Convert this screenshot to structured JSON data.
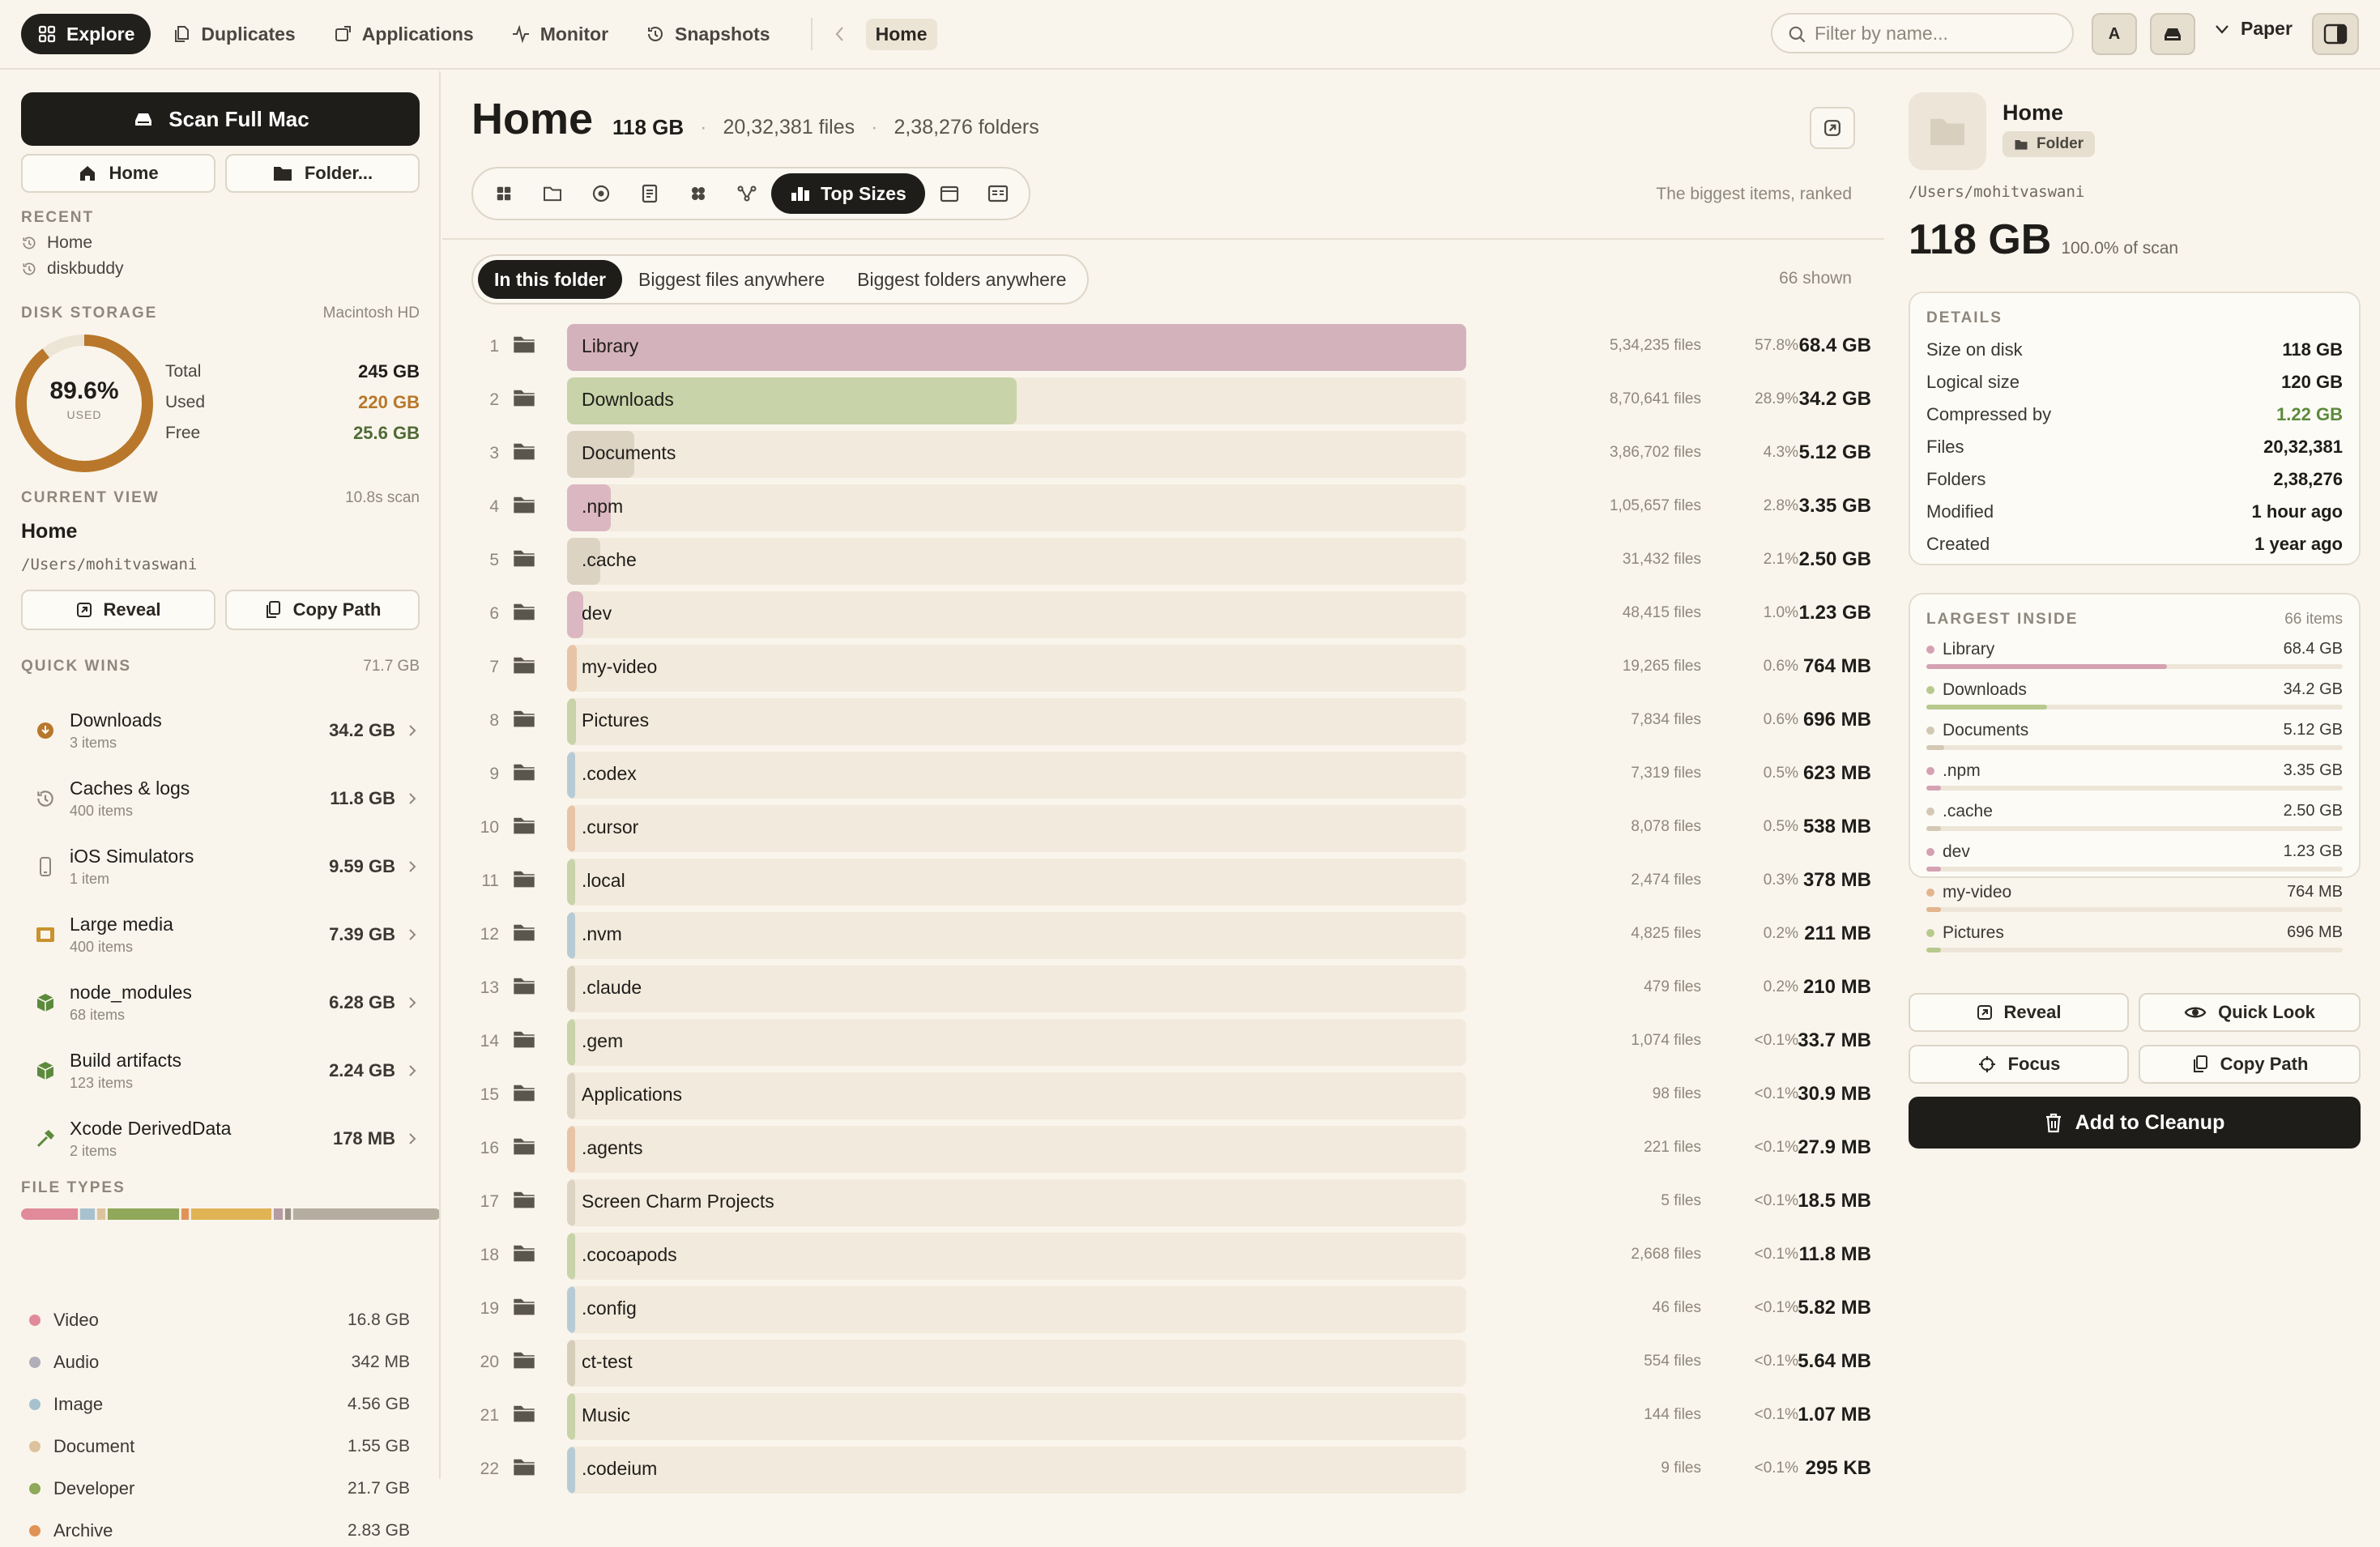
{
  "nav": {
    "tabs": [
      {
        "label": "Explore",
        "icon": "grid-icon"
      },
      {
        "label": "Duplicates",
        "icon": "files-icon"
      },
      {
        "label": "Applications",
        "icon": "app-icon"
      },
      {
        "label": "Monitor",
        "icon": "pulse-icon"
      },
      {
        "label": "Snapshots",
        "icon": "history-icon"
      }
    ],
    "breadcrumb": "Home",
    "search_placeholder": "Filter by name...",
    "avatar_letter": "A",
    "theme_label": "Paper"
  },
  "sidebar": {
    "scan_button": "Scan Full Mac",
    "home_button": "Home",
    "folder_button": "Folder...",
    "recent_heading": "RECENT",
    "recent": [
      "Home",
      "diskbuddy"
    ],
    "disk_heading": "DISK STORAGE",
    "disk_name": "Macintosh HD",
    "disk_percent": "89.6%",
    "disk_percent_value": 89.6,
    "disk_used_caption": "USED",
    "disk_rows": [
      {
        "label": "Total",
        "value": "245 GB",
        "color": "#1f1d1a"
      },
      {
        "label": "Used",
        "value": "220 GB",
        "color": "#b8772a"
      },
      {
        "label": "Free",
        "value": "25.6 GB",
        "color": "#4f6b35"
      }
    ],
    "current_heading": "CURRENT VIEW",
    "current_scan_time": "10.8s scan",
    "current_name": "Home",
    "current_path": "/Users/mohitvaswani",
    "reveal_button": "Reveal",
    "copy_path_button": "Copy Path",
    "quick_heading": "QUICK WINS",
    "quick_total": "71.7 GB",
    "quick_wins": [
      {
        "name": "Downloads",
        "sub": "3 items",
        "size": "34.2 GB",
        "icon": "download-icon",
        "color": "#b8772a"
      },
      {
        "name": "Caches & logs",
        "sub": "400 items",
        "size": "11.8 GB",
        "icon": "history-icon",
        "color": "#8d877c"
      },
      {
        "name": "iOS Simulators",
        "sub": "1 item",
        "size": "9.59 GB",
        "icon": "phone-icon",
        "color": "#8d877c"
      },
      {
        "name": "Large media",
        "sub": "400 items",
        "size": "7.39 GB",
        "icon": "film-icon",
        "color": "#c9922f"
      },
      {
        "name": "node_modules",
        "sub": "68 items",
        "size": "6.28 GB",
        "icon": "cube-icon",
        "color": "#5c8a3c"
      },
      {
        "name": "Build artifacts",
        "sub": "123 items",
        "size": "2.24 GB",
        "icon": "cube-icon",
        "color": "#5c8a3c"
      },
      {
        "name": "Xcode DerivedData",
        "sub": "2 items",
        "size": "178 MB",
        "icon": "hammer-icon",
        "color": "#5c8a3c"
      }
    ],
    "filetypes_heading": "FILE TYPES",
    "filetype_bar": [
      {
        "share": 0.135,
        "color": "#e08a9a"
      },
      {
        "share": 0.006,
        "color": "#f1ece2"
      },
      {
        "share": 0.035,
        "color": "#a7c1cf"
      },
      {
        "share": 0.006,
        "color": "#f1ece2"
      },
      {
        "share": 0.018,
        "color": "#dcc39d"
      },
      {
        "share": 0.006,
        "color": "#f1ece2"
      },
      {
        "share": 0.17,
        "color": "#8fa85a"
      },
      {
        "share": 0.006,
        "color": "#f1ece2"
      },
      {
        "share": 0.018,
        "color": "#e09357"
      },
      {
        "share": 0.006,
        "color": "#f1ece2"
      },
      {
        "share": 0.19,
        "color": "#e0b355"
      },
      {
        "share": 0.006,
        "color": "#f1ece2"
      },
      {
        "share": 0.022,
        "color": "#b59ba2"
      },
      {
        "share": 0.006,
        "color": "#f1ece2"
      },
      {
        "share": 0.012,
        "color": "#9b9187"
      },
      {
        "share": 0.006,
        "color": "#f1ece2"
      },
      {
        "share": 0.348,
        "color": "#b5ad9f"
      }
    ],
    "file_types": [
      {
        "name": "Video",
        "size": "16.8 GB",
        "color": "#e08a9a"
      },
      {
        "name": "Audio",
        "size": "342 MB",
        "color": "#b0aeb8"
      },
      {
        "name": "Image",
        "size": "4.56 GB",
        "color": "#a7c1cf"
      },
      {
        "name": "Document",
        "size": "1.55 GB",
        "color": "#dcc39d"
      },
      {
        "name": "Developer",
        "size": "21.7 GB",
        "color": "#8fa85a"
      },
      {
        "name": "Archive",
        "size": "2.83 GB",
        "color": "#e09357"
      }
    ]
  },
  "main": {
    "title": "Home",
    "size": "118 GB",
    "files": "20,32,381 files",
    "folders": "2,38,276 folders",
    "active_view": "Top Sizes",
    "view_hint": "The biggest items, ranked",
    "scopes": [
      "In this folder",
      "Biggest files anywhere",
      "Biggest folders anywhere"
    ],
    "shown_count": "66 shown",
    "rows": [
      {
        "rank": "1",
        "name": "Library",
        "files": "5,34,235 files",
        "pct": "57.8%",
        "size": "68.4 GB",
        "share": 1.0,
        "color": "#d4b2bc"
      },
      {
        "rank": "2",
        "name": "Downloads",
        "files": "8,70,641 files",
        "pct": "28.9%",
        "size": "34.2 GB",
        "share": 0.5,
        "color": "#c8d3a9"
      },
      {
        "rank": "3",
        "name": "Documents",
        "files": "3,86,702 files",
        "pct": "4.3%",
        "size": "5.12 GB",
        "share": 0.075,
        "color": "#dcd3c3"
      },
      {
        "rank": "4",
        "name": ".npm",
        "files": "1,05,657 files",
        "pct": "2.8%",
        "size": "3.35 GB",
        "share": 0.049,
        "color": "#dbb7c1"
      },
      {
        "rank": "5",
        "name": ".cache",
        "files": "31,432 files",
        "pct": "2.1%",
        "size": "2.50 GB",
        "share": 0.037,
        "color": "#dcd3c3"
      },
      {
        "rank": "6",
        "name": "dev",
        "files": "48,415 files",
        "pct": "1.0%",
        "size": "1.23 GB",
        "share": 0.018,
        "color": "#dbb7c1"
      },
      {
        "rank": "7",
        "name": "my-video",
        "files": "19,265 files",
        "pct": "0.6%",
        "size": "764 MB",
        "share": 0.011,
        "color": "#e8c4a6"
      },
      {
        "rank": "8",
        "name": "Pictures",
        "files": "7,834 files",
        "pct": "0.6%",
        "size": "696 MB",
        "share": 0.01,
        "color": "#c8d3a9"
      },
      {
        "rank": "9",
        "name": ".codex",
        "files": "7,319 files",
        "pct": "0.5%",
        "size": "623 MB",
        "share": 0.009,
        "color": "#b7cbd5"
      },
      {
        "rank": "10",
        "name": ".cursor",
        "files": "8,078 files",
        "pct": "0.5%",
        "size": "538 MB",
        "share": 0.008,
        "color": "#e8c4a6"
      },
      {
        "rank": "11",
        "name": ".local",
        "files": "2,474 files",
        "pct": "0.3%",
        "size": "378 MB",
        "share": 0.006,
        "color": "#c8d3a9"
      },
      {
        "rank": "12",
        "name": ".nvm",
        "files": "4,825 files",
        "pct": "0.2%",
        "size": "211 MB",
        "share": 0.005,
        "color": "#b7cbd5"
      },
      {
        "rank": "13",
        "name": ".claude",
        "files": "479 files",
        "pct": "0.2%",
        "size": "210 MB",
        "share": 0.005,
        "color": "#d6cdb9"
      },
      {
        "rank": "14",
        "name": ".gem",
        "files": "1,074 files",
        "pct": "<0.1%",
        "size": "33.7 MB",
        "share": 0.004,
        "color": "#c8d3a9"
      },
      {
        "rank": "15",
        "name": "Applications",
        "files": "98 files",
        "pct": "<0.1%",
        "size": "30.9 MB",
        "share": 0.004,
        "color": "#dcd3c3"
      },
      {
        "rank": "16",
        "name": ".agents",
        "files": "221 files",
        "pct": "<0.1%",
        "size": "27.9 MB",
        "share": 0.004,
        "color": "#e8c4a6"
      },
      {
        "rank": "17",
        "name": "Screen Charm Projects",
        "files": "5 files",
        "pct": "<0.1%",
        "size": "18.5 MB",
        "share": 0.004,
        "color": "#dcd3c3"
      },
      {
        "rank": "18",
        "name": ".cocoapods",
        "files": "2,668 files",
        "pct": "<0.1%",
        "size": "11.8 MB",
        "share": 0.004,
        "color": "#c8d3a9"
      },
      {
        "rank": "19",
        "name": ".config",
        "files": "46 files",
        "pct": "<0.1%",
        "size": "5.82 MB",
        "share": 0.004,
        "color": "#b7cbd5"
      },
      {
        "rank": "20",
        "name": "ct-test",
        "files": "554 files",
        "pct": "<0.1%",
        "size": "5.64 MB",
        "share": 0.004,
        "color": "#d6cdb9"
      },
      {
        "rank": "21",
        "name": "Music",
        "files": "144 files",
        "pct": "<0.1%",
        "size": "1.07 MB",
        "share": 0.004,
        "color": "#c8d3a9"
      },
      {
        "rank": "22",
        "name": ".codeium",
        "files": "9 files",
        "pct": "<0.1%",
        "size": "295 KB",
        "share": 0.004,
        "color": "#b7cbd5"
      }
    ]
  },
  "details": {
    "name": "Home",
    "kind": "Folder",
    "path": "/Users/mohitvaswani",
    "size": "118 GB",
    "scan_share": "100.0% of scan",
    "heading": "DETAILS",
    "rows": [
      {
        "label": "Size on disk",
        "value": "118 GB",
        "color": "#1f1d1a"
      },
      {
        "label": "Logical size",
        "value": "120 GB",
        "color": "#1f1d1a"
      },
      {
        "label": "Compressed by",
        "value": "1.22 GB",
        "color": "#5c8a3c"
      },
      {
        "label": "Files",
        "value": "20,32,381",
        "color": "#1f1d1a"
      },
      {
        "label": "Folders",
        "value": "2,38,276",
        "color": "#1f1d1a"
      },
      {
        "label": "Modified",
        "value": "1 hour ago",
        "color": "#1f1d1a"
      },
      {
        "label": "Created",
        "value": "1 year ago",
        "color": "#1f1d1a"
      }
    ],
    "largest_heading": "LARGEST INSIDE",
    "largest_count": "66 items",
    "largest": [
      {
        "name": "Library",
        "size": "68.4 GB",
        "share": 0.578,
        "color": "#d4a2b2"
      },
      {
        "name": "Downloads",
        "size": "34.2 GB",
        "share": 0.289,
        "color": "#b8c98d"
      },
      {
        "name": "Documents",
        "size": "5.12 GB",
        "share": 0.043,
        "color": "#d2c8b4"
      },
      {
        "name": ".npm",
        "size": "3.35 GB",
        "share": 0.028,
        "color": "#d4a2b2"
      },
      {
        "name": ".cache",
        "size": "2.50 GB",
        "share": 0.021,
        "color": "#d2c8b4"
      },
      {
        "name": "dev",
        "size": "1.23 GB",
        "share": 0.01,
        "color": "#d4a2b2"
      },
      {
        "name": "my-video",
        "size": "764 MB",
        "share": 0.006,
        "color": "#e3b48d"
      },
      {
        "name": "Pictures",
        "size": "696 MB",
        "share": 0.006,
        "color": "#b8c98d"
      }
    ],
    "reveal_button": "Reveal",
    "quicklook_button": "Quick Look",
    "focus_button": "Focus",
    "copy_path_button": "Copy Path",
    "cleanup_button": "Add to Cleanup"
  }
}
